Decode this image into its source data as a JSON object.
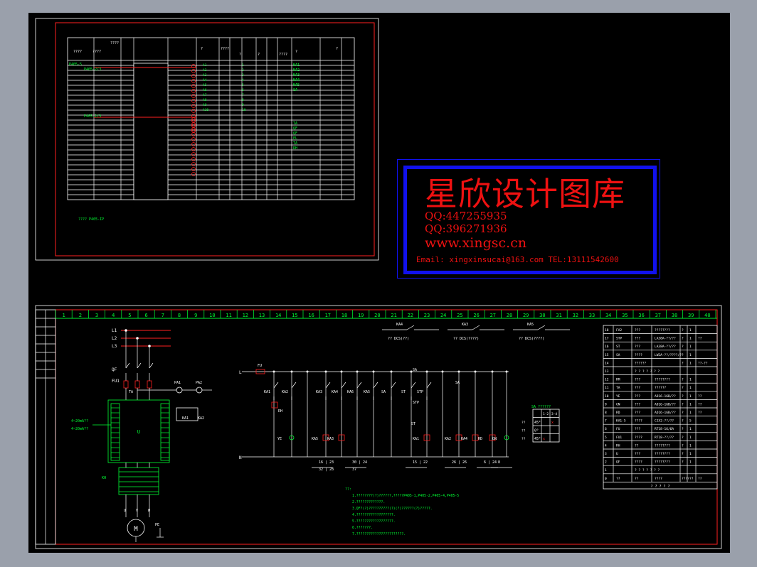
{
  "colors": {
    "background": "#000000",
    "frame": "#ffffff",
    "border": "#ff2020",
    "table": "#ffffff",
    "green": "#00ff33",
    "red": "#ff2020",
    "watermark_blue": "#1111ee"
  },
  "watermark": {
    "title": "星欣设计图库",
    "qq1": "QQ:447255935",
    "qq2": "QQ:396271936",
    "site": "www.xingsc.cn",
    "contact": "Email: xingxinsucai@163.com   TEL:13111542600"
  },
  "top_sheet": {
    "header": [
      "????",
      "????",
      "????",
      "?",
      "????",
      "?",
      "?",
      "????",
      "?",
      "?",
      "?",
      "????",
      "? ?"
    ],
    "rows_green_left": [
      "P405-5",
      "P405-2/3",
      "P405-2/3"
    ],
    "row_items": [
      "KA1",
      "KA2",
      "KA3",
      "KA4",
      "KA5",
      "SA",
      "TA",
      "QF",
      "QF",
      "EL",
      "TA",
      "RH"
    ],
    "footer_note": "???? P405-IP"
  },
  "bottom_sheet": {
    "columns": [
      "1",
      "2",
      "3",
      "4",
      "5",
      "6",
      "7",
      "8",
      "9",
      "10",
      "11",
      "12",
      "13",
      "14",
      "15",
      "16",
      "17",
      "18",
      "19",
      "20",
      "21",
      "22",
      "23",
      "24",
      "25",
      "26",
      "27",
      "28",
      "29",
      "30",
      "31",
      "32",
      "33",
      "34",
      "35",
      "36",
      "37",
      "38",
      "39",
      "40"
    ],
    "power_labels": [
      "L1",
      "L2",
      "L3",
      "N"
    ],
    "components": [
      "QF",
      "FU1",
      "TA",
      "PA1",
      "PA2",
      "U",
      "KA1",
      "KA2",
      "KH",
      "M",
      "PE"
    ],
    "control_labels": [
      "KA1",
      "KA2",
      "KA3",
      "KA4",
      "KA5",
      "KA6",
      "SA",
      "ST",
      "STP",
      "RH",
      "RD",
      "GN",
      "YE",
      "FU"
    ],
    "contact_refs": [
      "16 | 23",
      "30 | 24",
      "15 | 22",
      "26 | 26",
      "6 | 24",
      "8",
      "32 | 28",
      "37"
    ],
    "top_contacts": [
      "KA4",
      "KA3",
      "KA5"
    ],
    "top_contact_text": [
      "?? DCS(??)",
      "?? DCS(????)",
      "?? DCS(????)"
    ],
    "notes_title": "??:",
    "notes": [
      "1.????????(?)??????,?????P405-1,P405-2,P405-4,P405-5",
      "2.?????????????.",
      "3.QF?(?)??????????(?)(?)??????(?)?????.",
      "4.??????????????????.",
      "5.??????????????????.",
      "6.???????.",
      "7.???????????????????????."
    ],
    "sa_table": {
      "title": "SA ??????",
      "header": [
        "",
        "1-2",
        "3-4"
      ],
      "rows": [
        [
          "45°",
          "",
          "x"
        ],
        [
          "0°",
          "",
          ""
        ],
        [
          "45°",
          "x",
          ""
        ]
      ],
      "side": [
        "??",
        "??",
        "??"
      ]
    },
    "bom": [
      [
        "FA2",
        "???",
        "????????",
        "?",
        "1",
        ""
      ],
      [
        "STP",
        "???",
        "LA38A-??/??",
        "?",
        "1",
        "??"
      ],
      [
        "ST",
        "???",
        "LA38A-??/??",
        "?",
        "1",
        ""
      ],
      [
        "SA",
        "????",
        "LW2A-??/????/?",
        "?",
        "1",
        ""
      ],
      [
        "",
        "??????",
        "",
        "?",
        "1",
        "??-??"
      ],
      [
        "",
        "? ? ? ? ? ? ?",
        "",
        "",
        "",
        ""
      ],
      [
        "RM",
        "???",
        "????????",
        "?",
        "1",
        ""
      ],
      [
        "TA",
        "???",
        "??????",
        "?",
        "1",
        ""
      ],
      [
        "YE",
        "???",
        "AD16-16B/??",
        "?",
        "1",
        "??"
      ],
      [
        "GN",
        "???",
        "AD16-16B/??",
        "?",
        "1",
        "??"
      ],
      [
        "RD",
        "???",
        "AD16-16B/??",
        "?",
        "1",
        "??"
      ],
      [
        "KA1-5",
        "????",
        "CJX2-??/??",
        "?",
        "5",
        ""
      ],
      [
        "FU",
        "???",
        "RT18-16/6A",
        "?",
        "1",
        ""
      ],
      [
        "FU1",
        "????",
        "RT18-??/??",
        "?",
        "1",
        ""
      ],
      [
        "RH",
        "??",
        "????????",
        "?",
        "1",
        ""
      ],
      [
        "U",
        "???",
        "????????",
        "?",
        "1",
        ""
      ],
      [
        "QF",
        "????",
        "????????",
        "?",
        "1",
        ""
      ],
      [
        "",
        "? ? ? ? ? ? ?",
        "",
        "",
        "",
        ""
      ],
      [
        "??",
        "??",
        "????",
        "????",
        "??",
        "??"
      ]
    ],
    "bom_footer": "? ? ? ? ?"
  }
}
